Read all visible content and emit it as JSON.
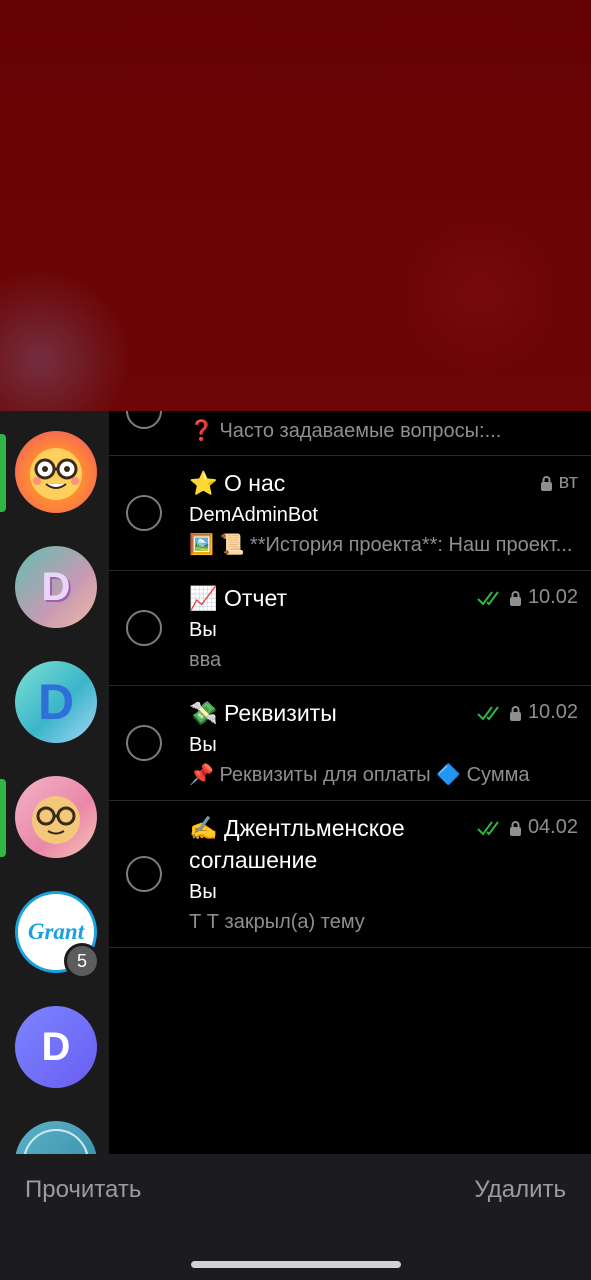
{
  "bottom_bar": {
    "read_label": "Прочитать",
    "delete_label": "Удалить"
  },
  "sidebar": {
    "chats": [
      {
        "name": "nerd-emoji-avatar",
        "letter": ""
      },
      {
        "name": "d-pink-avatar",
        "letter": "D"
      },
      {
        "name": "d-teal-avatar",
        "letter": "D"
      },
      {
        "name": "nerd-pink-avatar",
        "letter": ""
      },
      {
        "name": "grant-avatar",
        "text": "Grant",
        "badge": "5"
      },
      {
        "name": "d-purple-avatar",
        "letter": "D"
      },
      {
        "name": "partial-avatar",
        "letter": ""
      }
    ]
  },
  "topics": [
    {
      "emoji": "❓",
      "preview": "Часто задаваемые вопросы:..."
    },
    {
      "emoji": "⭐",
      "title": "О нас",
      "time": "вт",
      "sender": "DemAdminBot",
      "preview": "🖼️ 📜 **История проекта**: Наш проект...",
      "locked": true,
      "read": false
    },
    {
      "emoji": "📈",
      "title": "Отчет",
      "time": "10.02",
      "sender": "Вы",
      "preview": "вва",
      "locked": true,
      "read": true
    },
    {
      "emoji": "💸",
      "title": "Реквизиты",
      "time": "10.02",
      "sender": "Вы",
      "preview": "📌 Реквизиты для оплаты 🔷 Сумма",
      "locked": true,
      "read": true
    },
    {
      "emoji": "✍️",
      "title_line1": "Джентльменское",
      "title_line2": "соглашение",
      "time": "04.02",
      "sender": "Вы",
      "preview": "Т Т закрыл(а) тему",
      "locked": true,
      "read": true
    }
  ],
  "colors": {
    "read_check": "#31b545",
    "folder_indicator": "#31b545",
    "secondary_text": "#8e8e93"
  }
}
